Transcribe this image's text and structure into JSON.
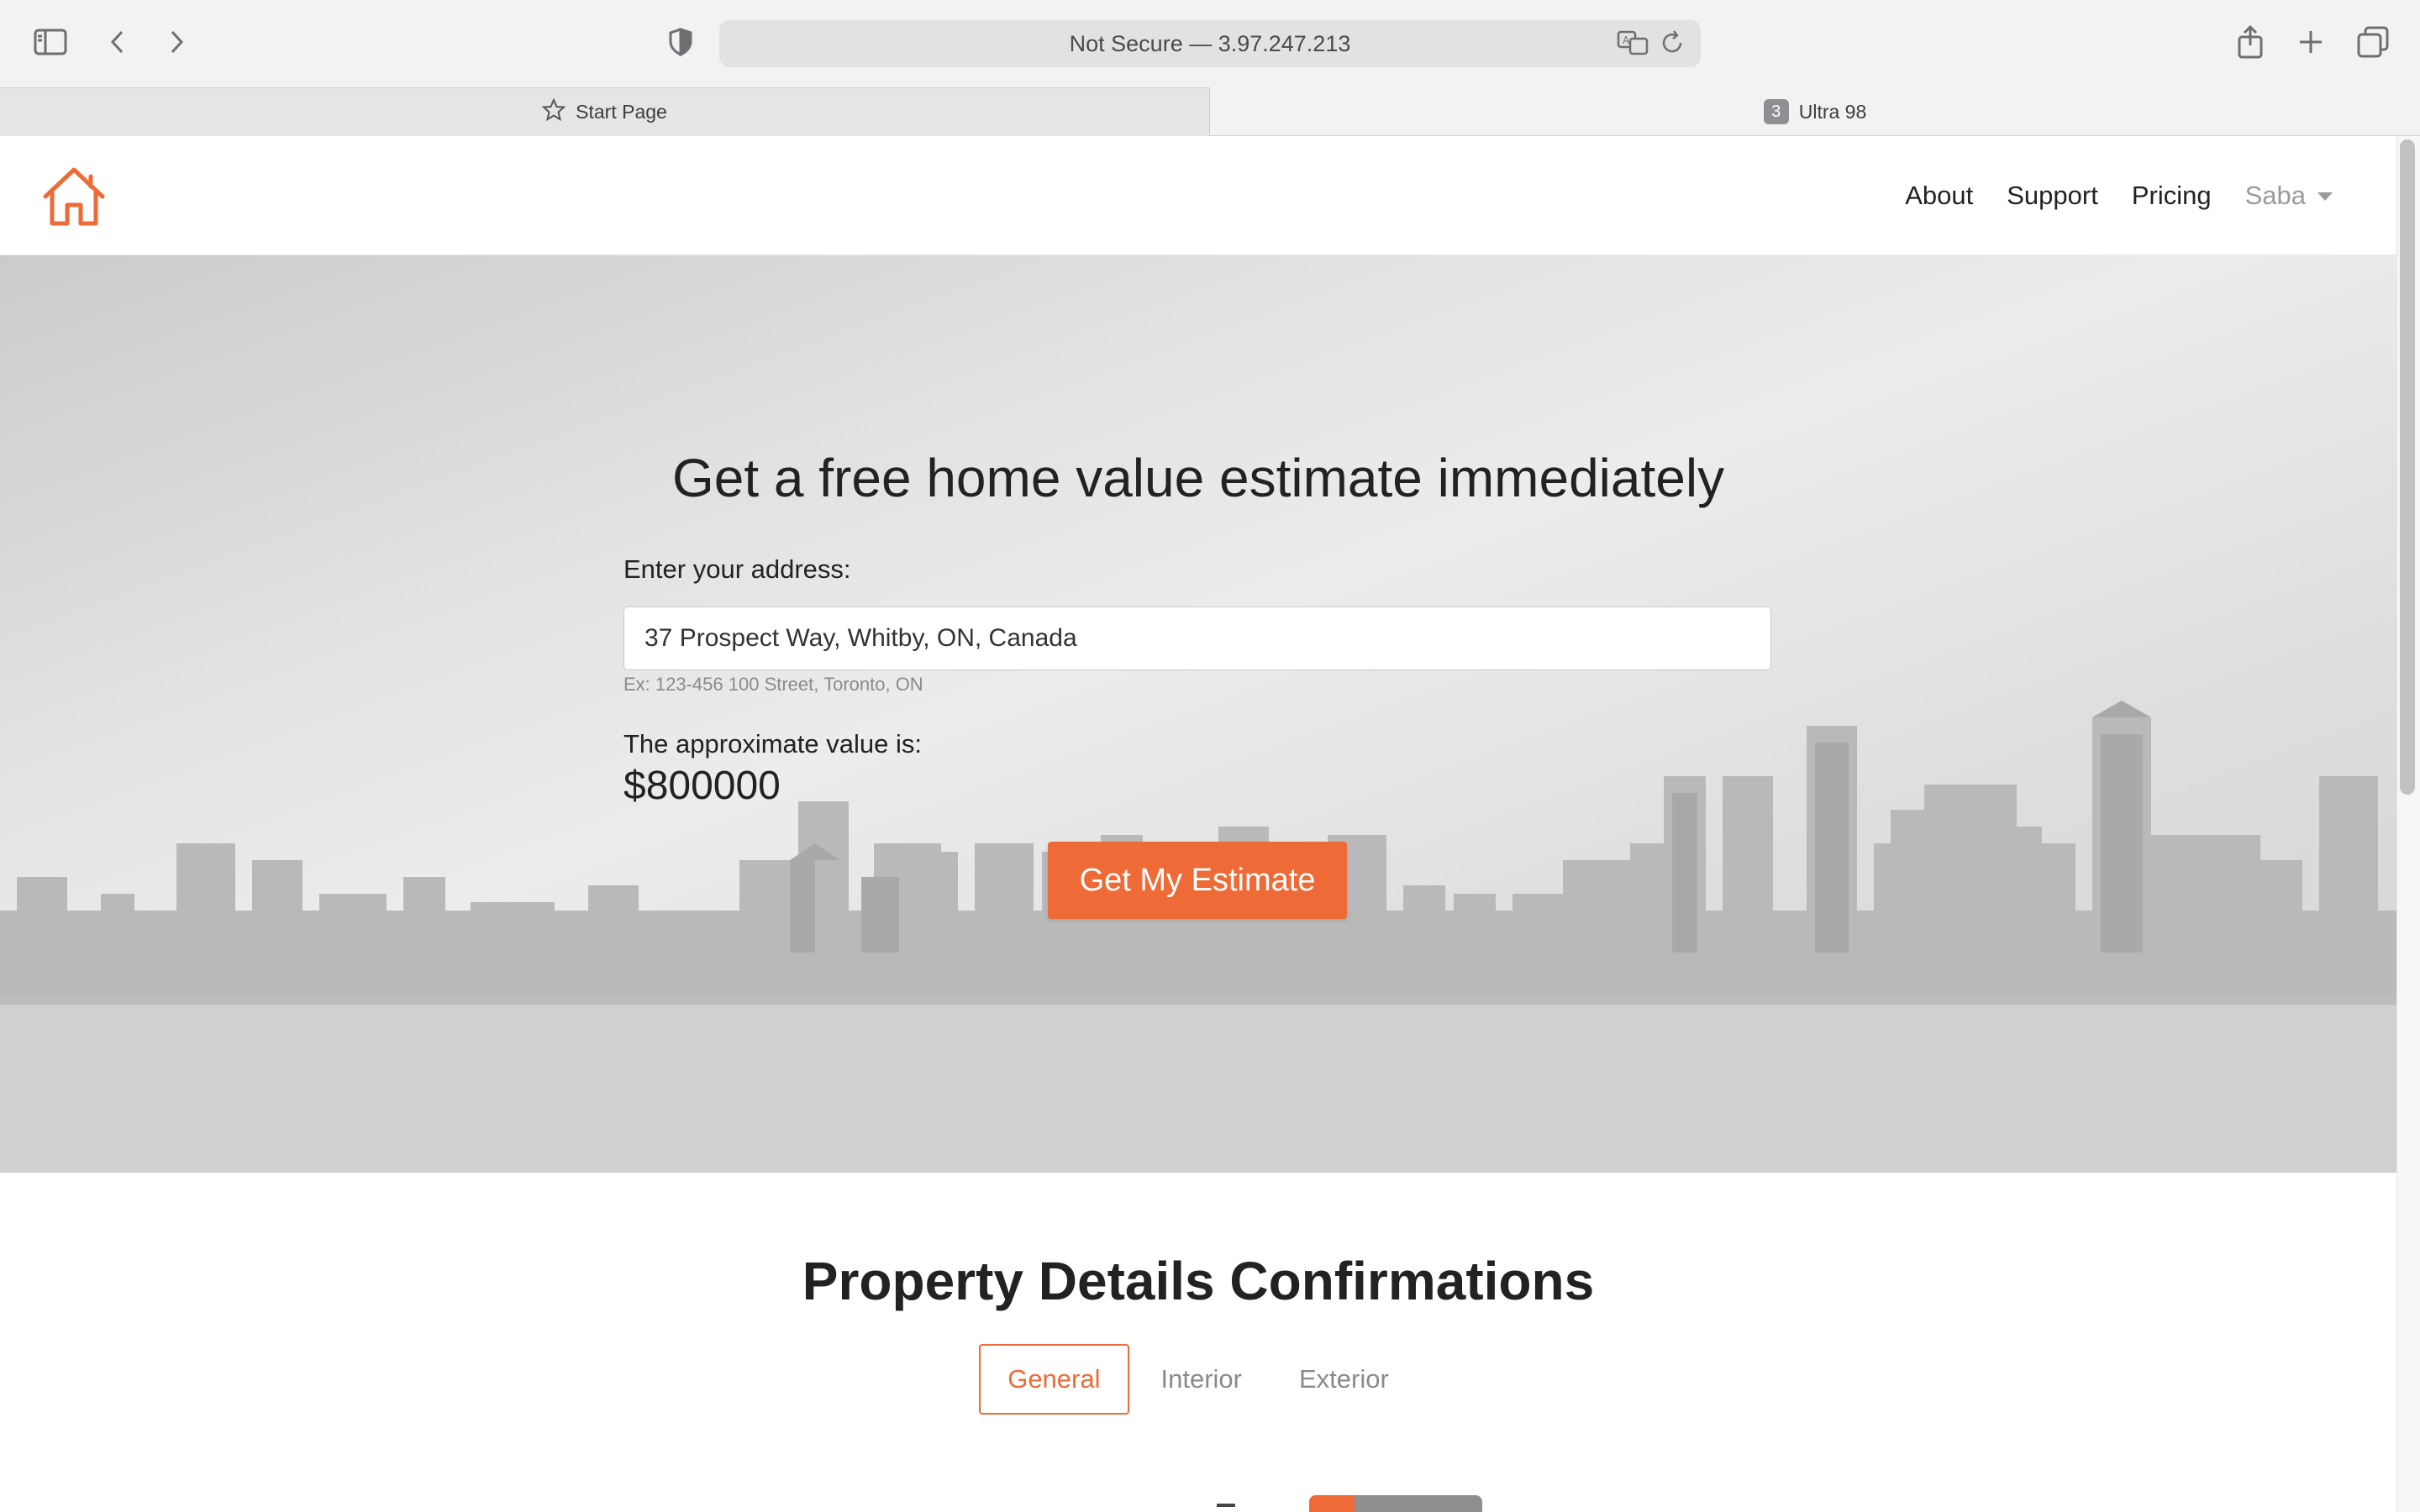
{
  "browser": {
    "address": "Not Secure — 3.97.247.213",
    "tabs": [
      {
        "label": "Start Page",
        "icon": "star-icon"
      },
      {
        "label": "Ultra 98",
        "badge": "3"
      }
    ]
  },
  "nav": {
    "links": [
      "About",
      "Support",
      "Pricing"
    ],
    "user": "Saba"
  },
  "hero": {
    "title": "Get a free home value estimate immediately",
    "address_label": "Enter your address:",
    "address_value": "37 Prospect Way, Whitby, ON, Canada",
    "address_hint": "Ex: 123-456 100 Street, Toronto, ON",
    "value_label": "The approximate value is:",
    "value": "$800000",
    "button": "Get My Estimate"
  },
  "details": {
    "title": "Property Details Confirmations",
    "tabs": [
      "General",
      "Interior",
      "Exterior"
    ],
    "active_tab": "General"
  },
  "colors": {
    "accent": "#ee6a36",
    "text": "#222222",
    "muted": "#8a8a8a"
  }
}
